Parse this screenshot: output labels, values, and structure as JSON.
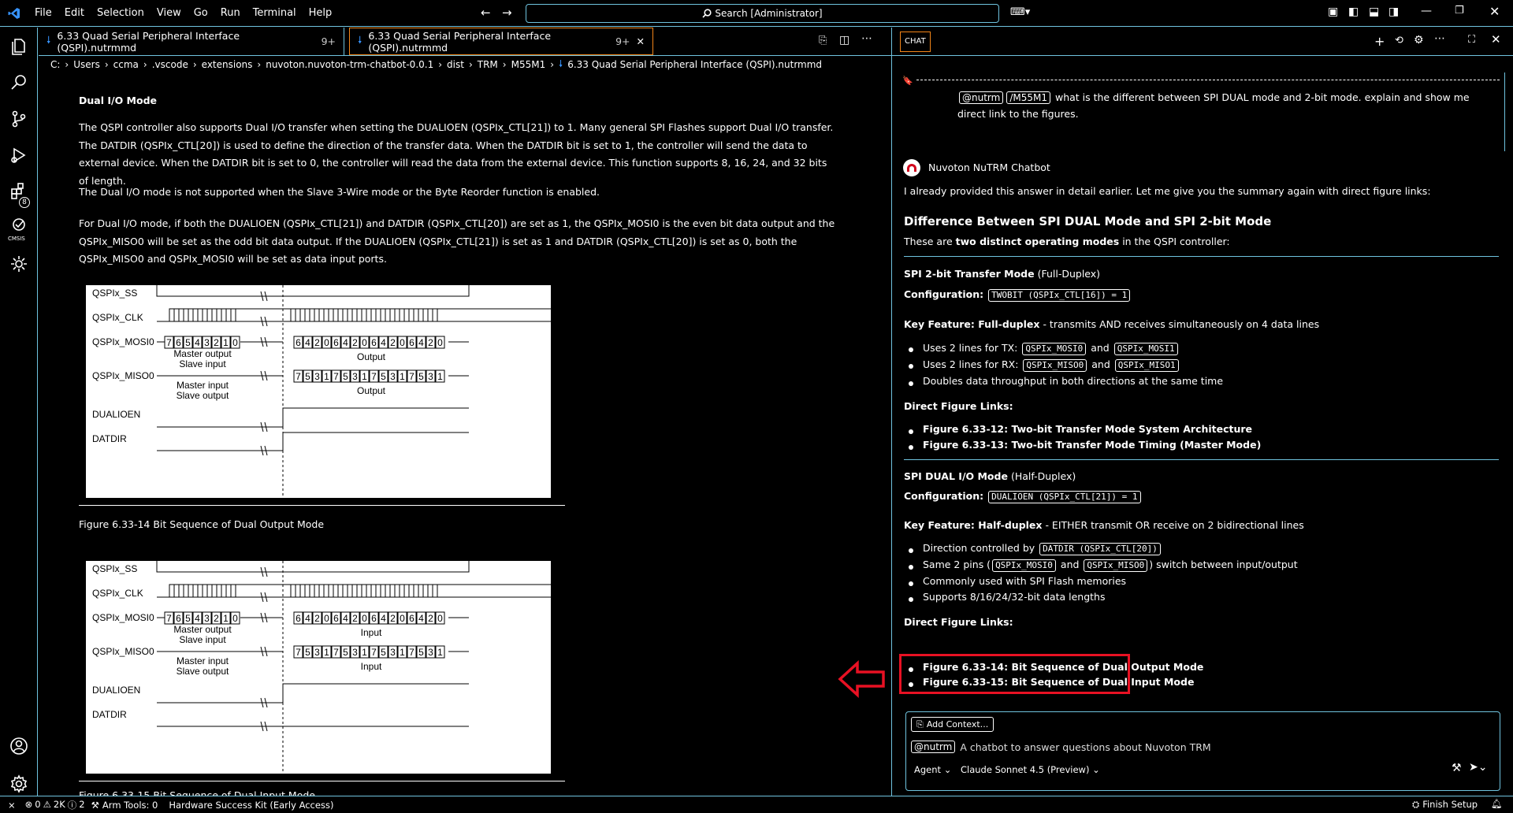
{
  "menu": [
    "File",
    "Edit",
    "Selection",
    "View",
    "Go",
    "Run",
    "Terminal",
    "Help"
  ],
  "search": {
    "label": "Search [Administrator]"
  },
  "tabs": [
    {
      "title": "6.33 Quad Serial Peripheral Interface (QSPI).nutrmmd",
      "badge": "9+"
    },
    {
      "title": "6.33 Quad Serial Peripheral Interface (QSPI).nutrmmd",
      "badge": "9+"
    }
  ],
  "breadcrumb": [
    "C:",
    "Users",
    "ccma",
    ".vscode",
    "extensions",
    "nuvoton.nuvoton-trm-chatbot-0.0.1",
    "dist",
    "TRM",
    "M55M1",
    "6.33 Quad Serial Peripheral Interface (QSPI).nutrmmd"
  ],
  "doc": {
    "heading": "Dual I/O Mode",
    "p1": "The QSPI controller also supports Dual I/O transfer when setting the DUALIOEN (QSPIx_CTL[21]) to 1. Many general SPI Flashes support Dual I/O transfer. The DATDIR (QSPIx_CTL[20]) is used to define the direction of the transfer data. When the DATDIR bit is set to 1, the controller will send the data to external device. When the DATDIR bit is set to 0, the controller will read the data from the external device. This function supports 8, 16, 24, and 32 bits of length.",
    "p2": "The Dual I/O mode is not supported when the Slave 3-Wire mode or the Byte Reorder function is enabled.",
    "p3": "For Dual I/O mode, if both the DUALIOEN (QSPIx_CTL[21]) and DATDIR (QSPIx_CTL[20]) are set as 1, the QSPIx_MOSI0 is the even bit data output and the QSPIx_MISO0 will be set as the odd bit data output. If the DUALIOEN (QSPIx_CTL[21]) is set as 1 and DATDIR (QSPIx_CTL[20]) is set as 0, both the QSPIx_MISO0 and QSPIx_MOSI0 will be set as data input ports.",
    "fig1_caption": "Figure 6.33-14 Bit Sequence of Dual Output Mode",
    "fig2_caption": "Figure 6.33-15 Bit Sequence of Dual Input Mode",
    "fig1": {
      "signals": [
        "QSPIx_SS",
        "QSPIx_CLK",
        "QSPIx_MOSI0",
        "QSPIx_MISO0",
        "DUALIOEN",
        "DATDIR"
      ],
      "mosi_note1": "Master output",
      "mosi_note2": "Slave input",
      "miso_note1": "Master input",
      "miso_note2": "Slave output",
      "mosi_right": "Output",
      "miso_right": "Output"
    },
    "fig2": {
      "signals": [
        "QSPIx_SS",
        "QSPIx_CLK",
        "QSPIx_MOSI0",
        "QSPIx_MISO0",
        "DUALIOEN",
        "DATDIR"
      ],
      "mosi_note1": "Master output",
      "mosi_note2": "Slave input",
      "miso_note1": "Master input",
      "miso_note2": "Slave output",
      "mosi_right": "Input",
      "miso_right": "Input"
    },
    "bits_left_mosi": [
      "7",
      "6",
      "5",
      "4",
      "3",
      "2",
      "1",
      "0"
    ],
    "bits_right_mosi": [
      "6",
      "4",
      "2",
      "0",
      "6",
      "4",
      "2",
      "0",
      "6",
      "4",
      "2",
      "0",
      "6",
      "4",
      "2",
      "0"
    ],
    "bits_right_miso": [
      "7",
      "5",
      "3",
      "1",
      "7",
      "5",
      "3",
      "1",
      "7",
      "5",
      "3",
      "1",
      "7",
      "5",
      "3",
      "1"
    ],
    "fig3_caption_partial": "Figure 6.33-15 Bit Sequence of Dual Input Mode"
  },
  "chat": {
    "panel_title": "CHAT",
    "user_msg": {
      "agent": "@nutrm",
      "cmd": "/M55M1",
      "text": "what is the different between SPI DUAL mode and 2-bit mode. explain and show me direct link to the figures."
    },
    "bot_name": "Nuvoton NuTRM Chatbot",
    "intro": "I already provided this answer in detail earlier. Let me give you the summary again with direct figure links:",
    "h2": "Difference Between SPI DUAL Mode and SPI 2-bit Mode",
    "these_pre": "These are ",
    "these_bold": "two distinct operating modes",
    "these_post": " in the QSPI controller:",
    "twobit": {
      "title": "SPI 2-bit Transfer Mode",
      "title_suffix": "(Full-Duplex)",
      "config_label": "Configuration:",
      "config_code": "TWOBIT (QSPIx_CTL[16]) = 1",
      "feature_label": "Key Feature: Full-duplex",
      "feature_text": "- transmits AND receives simultaneously on 4 data lines",
      "b1_pre": "Uses 2 lines for TX:",
      "b1_c1": "QSPIx_MOSI0",
      "b1_and": "and",
      "b1_c2": "QSPIx_MOSI1",
      "b2_pre": "Uses 2 lines for RX:",
      "b2_c1": "QSPIx_MISO0",
      "b2_and": "and",
      "b2_c2": "QSPIx_MISO1",
      "b3": "Doubles data throughput in both directions at the same time",
      "links_label": "Direct Figure Links:",
      "link1": "Figure 6.33-12: Two-bit Transfer Mode System Architecture",
      "link2": "Figure 6.33-13: Two-bit Transfer Mode Timing (Master Mode)"
    },
    "dual": {
      "title": "SPI DUAL I/O Mode",
      "title_suffix": "(Half-Duplex)",
      "config_label": "Configuration:",
      "config_code": "DUALIOEN (QSPIx_CTL[21]) = 1",
      "feature_label": "Key Feature: Half-duplex",
      "feature_text": "- EITHER transmit OR receive on 2 bidirectional lines",
      "b1_pre": "Direction controlled by",
      "b1_c1": "DATDIR (QSPIx_CTL[20])",
      "b2_pre": "Same 2 pins (",
      "b2_c1": "QSPIx_MOSI0",
      "b2_and": "and",
      "b2_c2": "QSPIx_MISO0",
      "b2_post": ") switch between input/output",
      "b3": "Commonly used with SPI Flash memories",
      "b4": "Supports 8/16/24/32-bit data lengths",
      "links_label": "Direct Figure Links:",
      "link1": "Figure 6.33-14: Bit Sequence of Dual Output Mode",
      "link2": "Figure 6.33-15: Bit Sequence of Dual Input Mode"
    },
    "input": {
      "add_context": "Add Context...",
      "agent_tag": "@nutrm",
      "placeholder": "A chatbot to answer questions about Nuvoton TRM",
      "mode": "Agent",
      "model": "Claude Sonnet 4.5 (Preview)"
    }
  },
  "status": {
    "remote": "⨯",
    "errors": "0",
    "warnings": "2K",
    "info": "2",
    "arm": "Arm Tools: 0",
    "kit": "Hardware Success Kit (Early Access)",
    "finish": "Finish Setup"
  },
  "colors": {
    "border": "#6fc3df",
    "accent_tab": "#f38518",
    "link": "#3794ff",
    "highlight": "#e81123"
  }
}
